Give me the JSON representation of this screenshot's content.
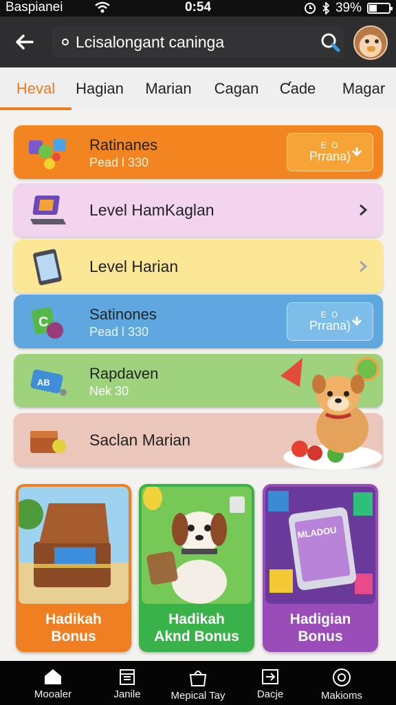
{
  "status": {
    "carrier": "Baspianei",
    "time": "0:54",
    "battery": "39%",
    "battery_level": 0.39
  },
  "search": {
    "placeholder": "Lcisalongant caninga"
  },
  "tabs": [
    {
      "label": "Heval",
      "active": true
    },
    {
      "label": "Hagian",
      "active": false
    },
    {
      "label": "Marian",
      "active": false
    },
    {
      "label": "Cagan",
      "active": false
    },
    {
      "label": "Ƈade",
      "active": false
    },
    {
      "label": "Magar",
      "active": false
    }
  ],
  "cards": [
    {
      "title": "Ratinanes",
      "subtitle": "Pead l 330",
      "button_top": "E O",
      "button_label": "Prrana)",
      "color": "#f28520"
    },
    {
      "title": "Level HamKaglan",
      "color": "#f2d4ef"
    },
    {
      "title": "Level Harian",
      "color": "#fbe795"
    },
    {
      "title": "Satinones",
      "subtitle": "Pead l 330",
      "button_top": "E O",
      "button_label": "Prrana)",
      "color": "#5ea8df"
    },
    {
      "title": "Rapdaven",
      "subtitle": "Nek 30",
      "color": "#9fd27c"
    },
    {
      "title": "Saclan Marian",
      "color": "#eac6bb"
    }
  ],
  "bonuses": [
    {
      "line1": "Hadikah",
      "line2": "Bonus",
      "color": "#f07f22"
    },
    {
      "line1": "Hadikah",
      "line2": "Aknd Bonus",
      "color": "#39b24a"
    },
    {
      "line1": "Hadigian",
      "line2": "Bonus",
      "color": "#9a4db8"
    }
  ],
  "phone_screen_text": "MLADOU",
  "nav": [
    {
      "label": "Mooaler",
      "icon": "home-icon"
    },
    {
      "label": "Janile",
      "icon": "calendar-icon"
    },
    {
      "label": "Mepical Tay",
      "icon": "bag-icon"
    },
    {
      "label": "Dacje",
      "icon": "share-icon"
    },
    {
      "label": "Makioms",
      "icon": "award-icon"
    }
  ]
}
